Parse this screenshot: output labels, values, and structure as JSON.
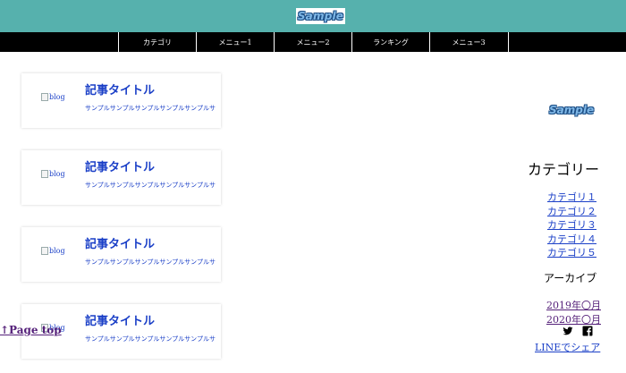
{
  "header": {
    "logo_text": "Sample"
  },
  "nav": {
    "items": [
      "カテゴリ",
      "メニュー1",
      "メニュー2",
      "ランキング",
      "メニュー3"
    ]
  },
  "articles": [
    {
      "image_alt": "blog",
      "title": "記事タイトル",
      "excerpt": "サンプルサンプルサンプルサンプルサンプルサ"
    },
    {
      "image_alt": "blog",
      "title": "記事タイトル",
      "excerpt": "サンプルサンプルサンプルサンプルサンプルサ"
    },
    {
      "image_alt": "blog",
      "title": "記事タイトル",
      "excerpt": "サンプルサンプルサンプルサンプルサンプルサ"
    },
    {
      "image_alt": "blog",
      "title": "記事タイトル",
      "excerpt": "サンプルサンプルサンプルサンプルサンプルサ"
    }
  ],
  "page_top": {
    "label": "↑Page top"
  },
  "sidebar": {
    "logo_text": "Sample",
    "category_heading": "カテゴリー",
    "categories": [
      "カテゴリ１",
      "カテゴリ２",
      "カテゴリ３",
      "カテゴリ４",
      "カテゴリ５"
    ],
    "archive_heading": "アーカイブ",
    "archives": [
      "2019年〇月",
      "2020年〇月"
    ],
    "share": {
      "icons": [
        "twitter-icon",
        "facebook-icon"
      ],
      "line_label": "LINEでシェア"
    }
  },
  "colors": {
    "header_bg": "#56b1ad",
    "nav_bg": "#000000",
    "link": "#1a3fc7",
    "visited_link": "#55217a"
  }
}
